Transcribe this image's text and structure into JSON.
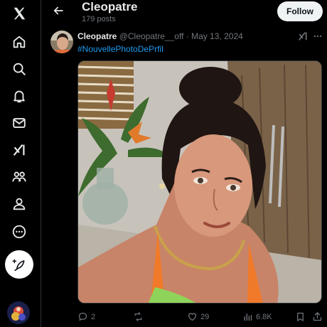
{
  "nav": {
    "items": [
      {
        "name": "x-logo-icon"
      },
      {
        "name": "home-icon"
      },
      {
        "name": "search-icon"
      },
      {
        "name": "notifications-icon"
      },
      {
        "name": "messages-icon"
      },
      {
        "name": "grok-icon"
      },
      {
        "name": "communities-icon"
      },
      {
        "name": "profile-icon"
      },
      {
        "name": "more-icon"
      }
    ],
    "post_button_icon": "feather-plus-icon"
  },
  "header": {
    "title": "Cleopatre",
    "subtitle": "179 posts",
    "follow_label": "Follow"
  },
  "tweet": {
    "display_name": "Cleopatre",
    "handle": "@Cleopatre__off",
    "separator": "·",
    "date": "May 13, 2024",
    "text": "#NouvellePhotoDePrfil",
    "actions": {
      "replies": "2",
      "reposts": "",
      "likes": "29",
      "views": "6.8K"
    }
  },
  "colors": {
    "background": "#000000",
    "accent": "#1d9bf0",
    "muted": "#71767b",
    "text": "#e7e9ea"
  }
}
